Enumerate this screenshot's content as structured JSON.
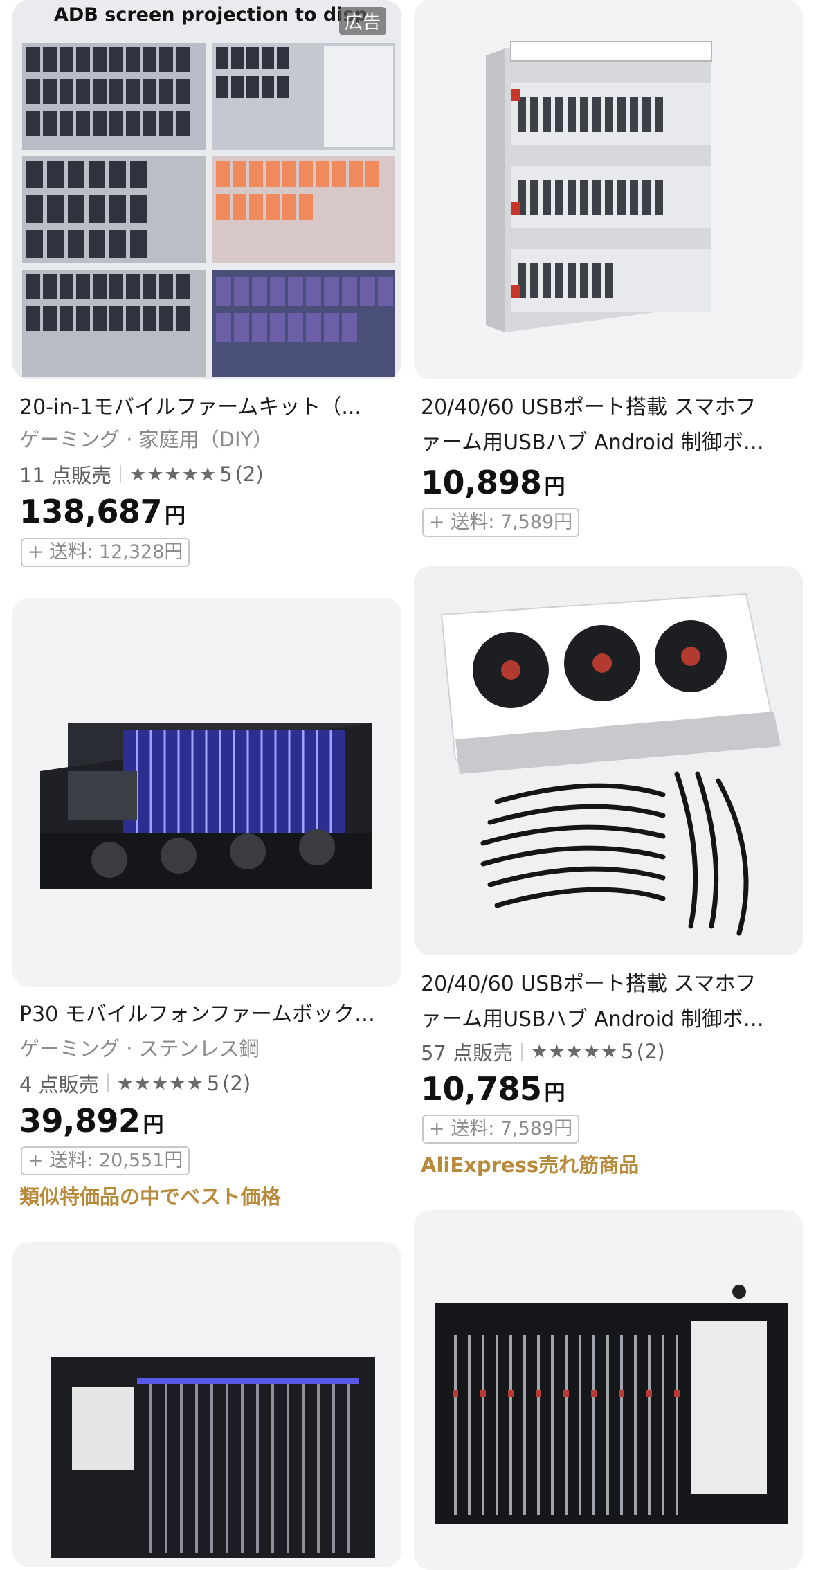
{
  "products": [
    {
      "id": "p1",
      "image_caption": "ADB screen projection to disp",
      "ad_label": "広告",
      "title_line1": "20-in-1モバイルファームキット（...",
      "subtitle": "ゲーミング · 家庭用（DIY）",
      "sold": "11 点販売",
      "stars": "★★★★★",
      "rating": "5",
      "reviews": "(2)",
      "price": "138,687",
      "currency": "円",
      "shipping": "+ 送料: 12,328円"
    },
    {
      "id": "p2",
      "title_line1": "20/40/60 USBポート搭載 スマホフ",
      "title_line2": "ァーム用USBハブ Android 制御ボ…",
      "price": "10,898",
      "currency": "円",
      "shipping": "+ 送料: 7,589円"
    },
    {
      "id": "p3",
      "title_line1": "P30 モバイルフォンファームボック…",
      "subtitle": "ゲーミング · ステンレス鋼",
      "sold": "4 点販売",
      "stars": "★★★★★",
      "rating": "5",
      "reviews": "(2)",
      "price": "39,892",
      "currency": "円",
      "shipping": "+ 送料: 20,551円",
      "promo": "類似特価品の中でベスト価格"
    },
    {
      "id": "p4",
      "title_line1": "20/40/60 USBポート搭載 スマホフ",
      "title_line2": "ァーム用USBハブ Android 制御ボ…",
      "sold": "57 点販売",
      "stars": "★★★★★",
      "rating": "5",
      "reviews": "(2)",
      "price": "10,785",
      "currency": "円",
      "shipping": "+ 送料: 7,589円",
      "promo": "AliExpress売れ筋商品"
    }
  ],
  "colors": {
    "card_bg": "#f3f3f5",
    "promo_gold": "#b88a3c",
    "muted": "#8a8a8a"
  }
}
